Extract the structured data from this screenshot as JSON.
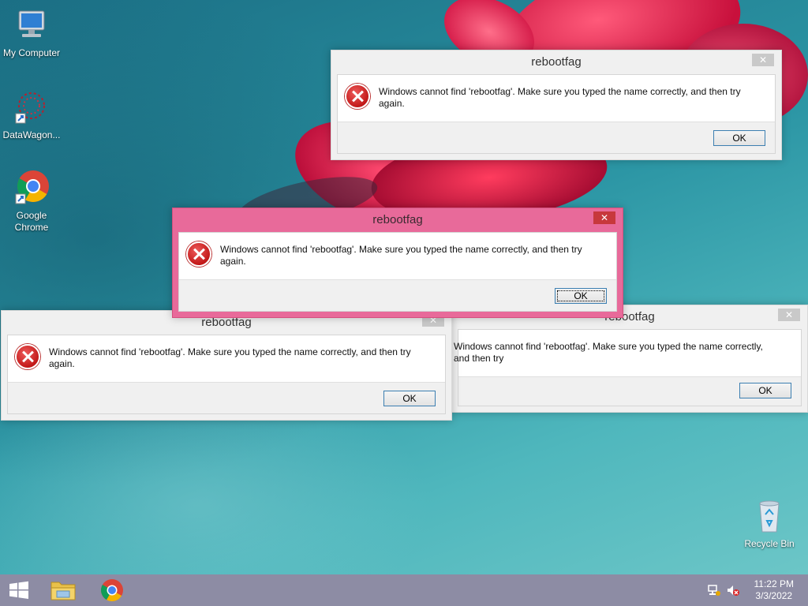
{
  "desktop_icons": [
    {
      "label": "My Computer"
    },
    {
      "label": "DataWagon..."
    },
    {
      "label": "Google Chrome"
    },
    {
      "label": "Recycle Bin"
    }
  ],
  "dialogs": [
    {
      "title": "rebootfag",
      "message": "Windows cannot find 'rebootfag'. Make sure you typed the name correctly, and then try again.",
      "ok_label": "OK",
      "close_label": "✕"
    },
    {
      "title": "rebootfag",
      "message": "Windows cannot find 'rebootfag'. Make sure you typed the name correctly, and then try again.",
      "ok_label": "OK",
      "close_label": "✕"
    },
    {
      "title": "rebootfag",
      "message": "Windows cannot find 'rebootfag'. Make sure you typed the name correctly, and then try again.",
      "ok_label": "OK",
      "close_label": "✕"
    },
    {
      "title": "rebootfag",
      "message": "Windows cannot find 'rebootfag'. Make sure you typed the name correctly, and then try",
      "ok_label": "OK",
      "close_label": "✕"
    }
  ],
  "taskbar": {
    "time": "11:22 PM",
    "date": "3/3/2022"
  },
  "colors": {
    "active_dialog_frame": "#e86a9a",
    "close_active": "#c7383c",
    "ok_border": "#3c7fb1"
  }
}
